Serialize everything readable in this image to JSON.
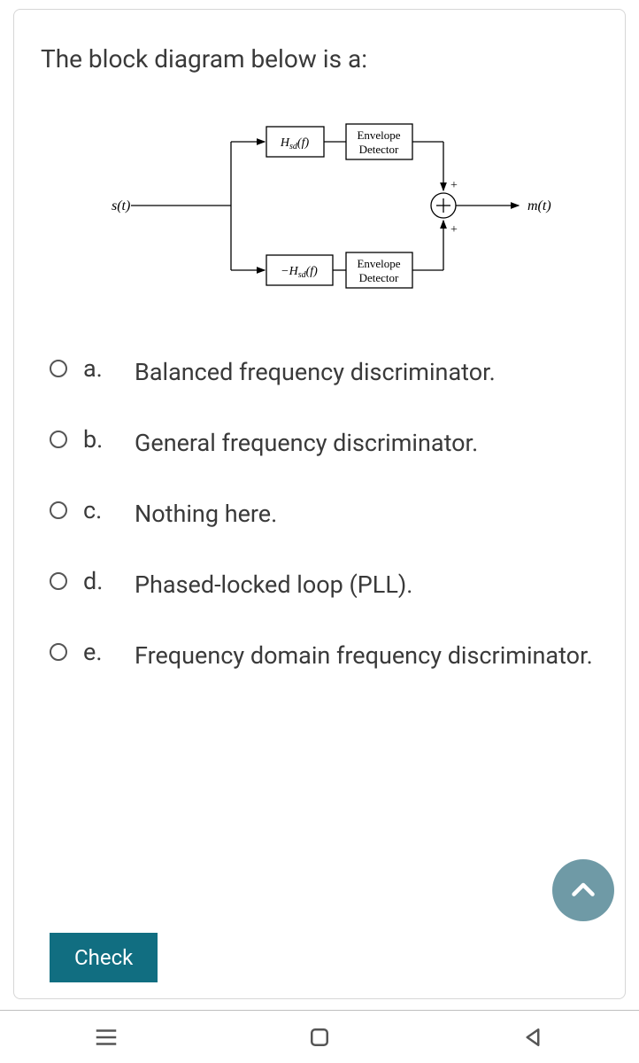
{
  "question": "The block diagram below is a:",
  "diagram": {
    "input": "s(t)",
    "output": "m(t)",
    "topFilter": "Hsd(f)",
    "bottomFilter": "−Hsd(f)",
    "envelope": "Envelope\nDetector",
    "sumPlusTop": "+",
    "sumPlusBottom": "+"
  },
  "options": [
    {
      "letter": "a.",
      "text": "Balanced frequency discriminator."
    },
    {
      "letter": "b.",
      "text": "General frequency discriminator."
    },
    {
      "letter": "c.",
      "text": "Nothing here."
    },
    {
      "letter": "d.",
      "text": "Phased-locked loop (PLL)."
    },
    {
      "letter": "e.",
      "text": "Frequency domain frequency discriminator."
    }
  ],
  "checkLabel": "Check"
}
